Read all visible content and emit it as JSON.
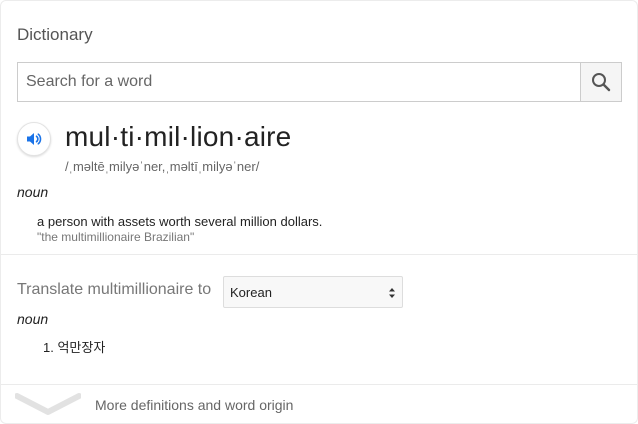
{
  "panel": {
    "title": "Dictionary"
  },
  "search": {
    "placeholder": "Search for a word",
    "value": ""
  },
  "entry": {
    "headword": "mul·ti·mil·lion·aire",
    "phonetic": "/ˌməltēˌmilyəˈner,ˌməltīˌmilyəˈner/",
    "part_of_speech": "noun",
    "definition": "a person with assets worth several million dollars.",
    "example": "\"the multimillionaire Brazilian\""
  },
  "translate": {
    "label": "Translate multimillionaire to",
    "selected_language": "Korean",
    "part_of_speech": "noun",
    "items": [
      {
        "number": "1.",
        "text": "억만장자"
      }
    ]
  },
  "footer": {
    "more_label": "More definitions and word origin"
  },
  "icons": {
    "search": "search-icon",
    "speaker": "speaker-icon",
    "select_arrows": "updown-arrows-icon",
    "more": "chevron-down-icon"
  },
  "colors": {
    "accent": "#1a73e8",
    "muted_text": "#777777"
  }
}
